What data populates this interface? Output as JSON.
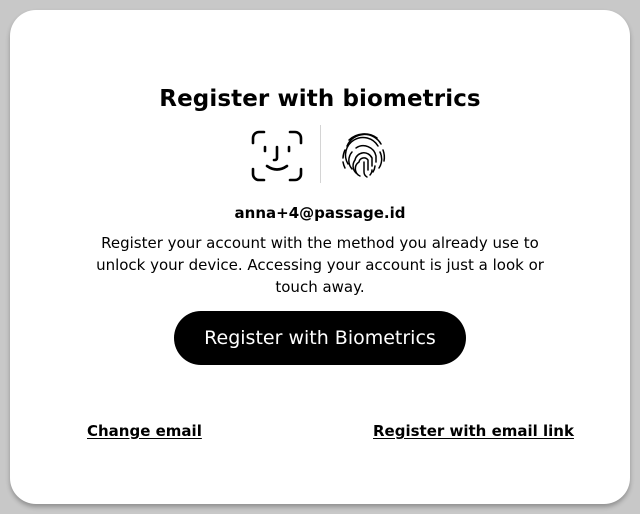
{
  "dialog": {
    "title": "Register with biometrics",
    "email": "anna+4@passage.id",
    "description": "Register your account with the method you already use to unlock your device. Accessing your account is just a look or touch away.",
    "primary_button_label": "Register with Biometrics",
    "change_email_label": "Change email",
    "register_email_link_label": "Register with email link"
  },
  "icons": {
    "face": "face-id-icon",
    "fingerprint": "fingerprint-icon"
  },
  "colors": {
    "button_bg": "#000000",
    "button_text": "#ffffff",
    "page_bg": "#c8c8c8",
    "card_bg": "#ffffff"
  }
}
